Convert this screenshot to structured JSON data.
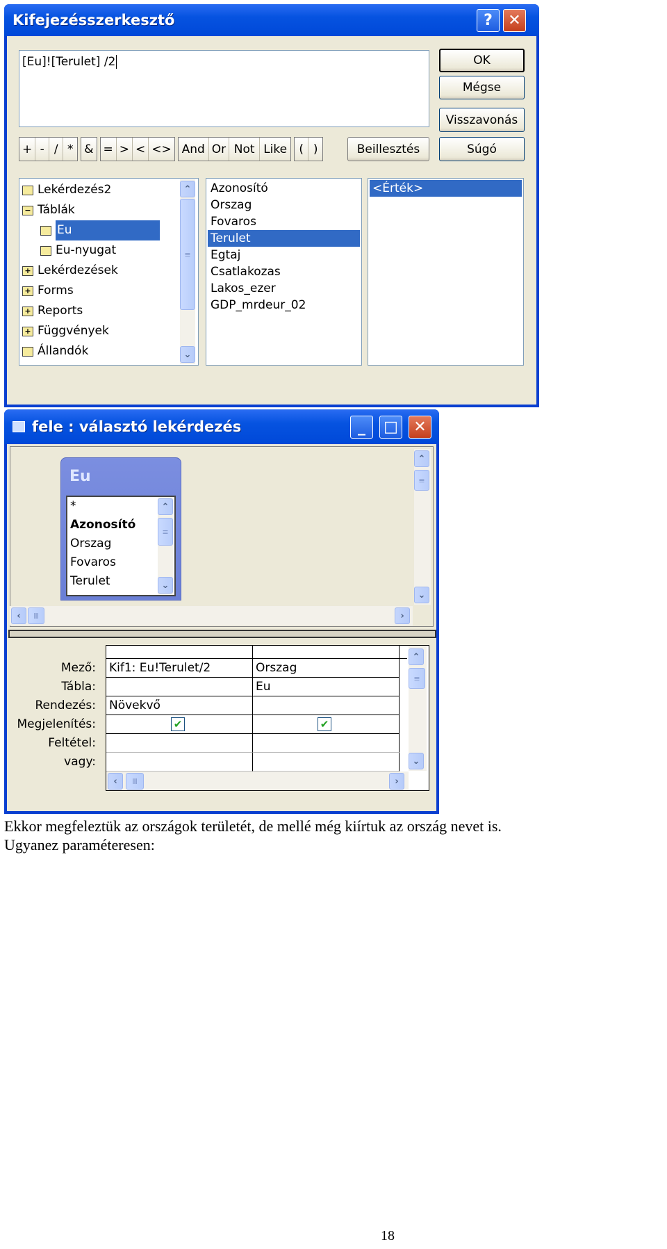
{
  "expression_builder": {
    "title": "Kifejezésszerkesztő",
    "expression": "[Eu]![Terulet] /2",
    "buttons": {
      "ok": "OK",
      "cancel": "Mégse",
      "undo": "Visszavonás",
      "help": "Súgó",
      "paste": "Beillesztés"
    },
    "operator_groups": [
      [
        "+",
        "-",
        "/",
        "*"
      ],
      [
        "&"
      ],
      [
        "=",
        ">",
        "<",
        "<>"
      ],
      [
        "And",
        "Or",
        "Not",
        "Like"
      ],
      [
        "(",
        ")"
      ]
    ],
    "tree": [
      {
        "label": "Lekérdezés2",
        "icon": "folder-icon"
      },
      {
        "label": "Táblák",
        "icon": "folder-minus-icon"
      },
      {
        "label": "Eu",
        "icon": "folder-open-icon",
        "selected": true
      },
      {
        "label": "Eu-nyugat",
        "icon": "folder-icon"
      },
      {
        "label": "Lekérdezések",
        "icon": "folder-plus-icon"
      },
      {
        "label": "Forms",
        "icon": "folder-plus-icon"
      },
      {
        "label": "Reports",
        "icon": "folder-plus-icon"
      },
      {
        "label": "Függvények",
        "icon": "folder-plus-icon"
      },
      {
        "label": "Állandók",
        "icon": "folder-icon"
      }
    ],
    "fields": [
      "Azonosító",
      "Orszag",
      "Fovaros",
      "Terulet",
      "Egtaj",
      "Csatlakozas",
      "Lakos_ezer",
      "GDP_mrdeur_02"
    ],
    "selected_field": "Terulet",
    "values": [
      "<Érték>"
    ]
  },
  "query_window": {
    "title": "fele : választó lekérdezés",
    "table": {
      "name": "Eu",
      "fields": [
        "*",
        "Azonosító",
        "Orszag",
        "Fovaros",
        "Terulet"
      ]
    },
    "row_labels": [
      "Mező:",
      "Tábla:",
      "Rendezés:",
      "Megjelenítés:",
      "Feltétel:",
      "vagy:"
    ],
    "columns": [
      {
        "field": "Kif1: Eu!Terulet/2",
        "table": "",
        "sort": "Növekvő",
        "show": true,
        "criteria": "",
        "or": ""
      },
      {
        "field": "Orszag",
        "table": "Eu",
        "sort": "",
        "show": true,
        "criteria": "",
        "or": ""
      }
    ]
  },
  "document": {
    "line1": "Ekkor megfeleztük az országok területét, de mellé még kiírtuk az ország nevet is.",
    "line2": "Ugyanez paraméteresen:",
    "page_number": "18"
  }
}
